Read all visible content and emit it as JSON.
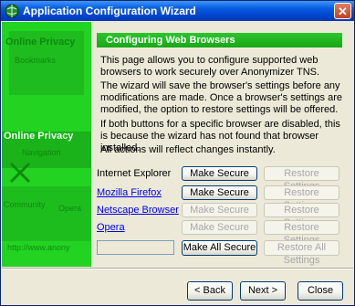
{
  "window": {
    "title": "Application Configuration Wizard",
    "close_label": "✕"
  },
  "banner": {
    "lines": [
      "Online Privacy",
      "Bookmarks",
      "Online Privacy",
      "Navigation",
      "Community",
      "Opera",
      "http://www.anony"
    ]
  },
  "header": {
    "title": "Configuring Web Browsers"
  },
  "paragraphs": [
    "This page allows you to configure supported web browsers to work securely over Anonymizer TNS.",
    "The wizard will save the browser's settings before any modifications are made. Once a browser's settings are modified, the option to restore settings will be offered.",
    "If both buttons for a specific browser are disabled, this is because the wizard has not found that browser installed.",
    "All actions will reflect changes instantly."
  ],
  "browsers": [
    {
      "name": "Internet Explorer",
      "make_secure": "Make Secure",
      "restore": "Restore Settings"
    },
    {
      "name": "Mozilla Firefox",
      "make_secure": "Make Secure",
      "restore": "Restore Settings"
    },
    {
      "name": "Netscape Browser",
      "make_secure": "Make Secure",
      "restore": "Restore Settings"
    },
    {
      "name": "Opera",
      "make_secure": "Make Secure",
      "restore": "Restore Settings"
    }
  ],
  "all_actions": {
    "make_all_secure": "Make All Secure",
    "restore_all": "Restore All Settings"
  },
  "nav": {
    "back": "< Back",
    "next": "Next >",
    "close": "Close"
  }
}
